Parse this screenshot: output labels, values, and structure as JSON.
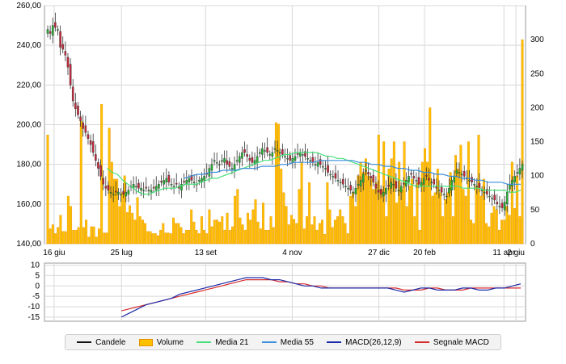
{
  "colors": {
    "grid": "#d8d8d8",
    "frame": "#9a9a9a",
    "candle_up": "#22b530",
    "candle_down": "#c7263a",
    "volume_fill": "#ffc000",
    "volume_stroke": "#e89000",
    "media21": "#46e07a",
    "media55": "#3a8fdc",
    "macd": "#1a2aa8",
    "signal": "#d62a2a"
  },
  "price_axis": {
    "min": 140,
    "max": 260,
    "ticks": [
      "140,00",
      "160,00",
      "180,00",
      "200,00",
      "220,00",
      "240,00",
      "260,00"
    ]
  },
  "volume_axis": {
    "min": 0,
    "max": 350,
    "ticks": [
      "0",
      "50",
      "100",
      "150",
      "200",
      "250",
      "300"
    ]
  },
  "macd_axis": {
    "min": -17,
    "max": 11,
    "ticks": [
      "10",
      "5",
      "0",
      "-5",
      "-10",
      "-15"
    ]
  },
  "x_axis": {
    "labels": [
      {
        "text": "16 giu",
        "t": 0.02
      },
      {
        "text": "25 lug",
        "t": 0.16
      },
      {
        "text": "13 set",
        "t": 0.335
      },
      {
        "text": "4 nov",
        "t": 0.515
      },
      {
        "text": "27 dic",
        "t": 0.695
      },
      {
        "text": "20 feb",
        "t": 0.79
      },
      {
        "text": "11 apr",
        "t": 0.955
      },
      {
        "text": "2 giu",
        "t": 0.98
      }
    ]
  },
  "chart_data": {
    "type": "candlestick",
    "price_close": [
      248,
      246,
      250,
      249,
      248,
      239,
      238,
      235,
      229,
      220,
      212,
      208,
      205,
      202,
      198,
      196,
      193,
      190,
      186,
      182,
      178,
      174,
      170,
      168,
      167,
      166,
      165,
      166,
      166,
      165,
      165,
      166,
      167,
      169,
      170,
      169,
      168,
      168,
      167,
      168,
      167,
      167,
      168,
      169,
      170,
      171,
      172,
      173,
      171,
      170,
      169,
      170,
      168,
      170,
      171,
      172,
      173,
      172,
      171,
      170,
      172,
      173,
      174,
      175,
      178,
      180,
      182,
      181,
      180,
      182,
      183,
      180,
      179,
      178,
      180,
      182,
      184,
      186,
      186,
      184,
      182,
      181,
      182,
      184,
      186,
      188,
      187,
      186,
      185,
      186,
      188,
      187,
      186,
      185,
      184,
      183,
      182,
      183,
      184,
      185,
      186,
      185,
      184,
      183,
      182,
      181,
      180,
      181,
      180,
      179,
      178,
      176,
      175,
      174,
      173,
      172,
      171,
      170,
      169,
      168,
      167,
      166,
      168,
      170,
      172,
      175,
      177,
      175,
      173,
      171,
      168,
      166,
      165,
      166,
      168,
      169,
      171,
      170,
      168,
      167,
      169,
      170,
      172,
      174,
      175,
      173,
      172,
      170,
      171,
      173,
      174,
      172,
      171,
      170,
      168,
      167,
      166,
      165,
      164,
      168,
      172,
      174,
      177,
      176,
      175,
      174,
      173,
      172,
      171,
      170,
      169,
      168,
      167,
      166,
      165,
      164,
      163,
      162,
      160,
      159,
      158,
      161,
      166,
      170,
      172,
      174,
      176,
      178,
      180
    ],
    "media21": [
      178,
      176,
      175,
      172,
      170,
      168,
      166,
      165,
      165,
      166,
      167,
      168,
      168,
      168,
      169,
      170,
      170,
      170,
      171,
      172,
      173,
      173,
      174,
      175,
      176,
      177,
      178,
      179,
      180,
      181,
      182,
      182,
      183,
      184,
      185,
      185,
      186,
      186,
      186,
      186,
      186,
      185,
      184,
      184,
      183,
      183,
      182,
      181,
      180,
      179,
      178,
      177,
      176,
      175,
      174,
      173,
      172,
      171,
      170,
      169,
      169,
      169,
      169,
      169,
      169,
      169,
      169,
      169,
      168,
      168,
      168,
      168,
      167,
      167,
      167,
      167,
      167,
      166,
      166,
      167
    ],
    "media55": [
      173,
      174,
      175,
      175,
      176,
      176,
      177,
      177,
      177,
      178,
      178,
      178,
      179,
      179,
      179,
      180,
      180,
      181,
      181,
      181,
      181,
      182,
      182,
      182,
      182,
      182,
      182,
      181,
      181,
      180,
      180,
      179,
      179,
      178,
      178,
      177,
      177,
      176,
      176,
      175,
      175,
      174,
      174,
      173,
      173,
      172,
      172,
      171,
      171,
      171,
      170,
      170,
      170
    ],
    "volume": [
      160,
      22,
      28,
      15,
      24,
      42,
      18,
      18,
      70,
      55,
      20,
      20,
      24,
      180,
      24,
      35,
      10,
      25,
      25,
      10,
      22,
      205,
      16,
      16,
      170,
      120,
      95,
      95,
      55,
      75,
      100,
      46,
      56,
      45,
      35,
      68,
      40,
      35,
      30,
      18,
      18,
      15,
      15,
      12,
      20,
      30,
      16,
      16,
      15,
      38,
      30,
      30,
      24,
      15,
      20,
      20,
      50,
      32,
      20,
      15,
      40,
      20,
      15,
      50,
      25,
      35,
      35,
      32,
      40,
      20,
      45,
      20,
      25,
      70,
      80,
      38,
      28,
      20,
      45,
      35,
      50,
      65,
      32,
      22,
      60,
      20,
      20,
      40,
      24,
      178,
      176,
      110,
      75,
      55,
      28,
      42,
      36,
      30,
      80,
      120,
      22,
      40,
      90,
      28,
      40,
      20,
      30,
      35,
      14,
      90,
      50,
      24,
      35,
      40,
      50,
      40,
      30,
      15,
      70,
      76,
      55,
      100,
      120,
      105,
      125,
      100,
      95,
      80,
      90,
      160,
      80,
      150,
      40,
      110,
      125,
      150,
      60,
      120,
      80,
      150,
      55,
      85,
      95,
      40,
      90,
      20,
      120,
      140,
      120,
      200,
      70,
      75,
      110,
      75,
      40,
      65,
      75,
      105,
      40,
      130,
      110,
      145,
      80,
      70,
      150,
      35,
      30,
      85,
      160,
      70,
      95,
      30,
      25,
      45,
      55,
      50,
      20,
      35,
      35,
      55,
      42,
      120,
      52,
      100,
      40,
      300
    ],
    "macd": [
      -15,
      -13,
      -11,
      -9,
      -8,
      -7,
      -6,
      -4,
      -3,
      -2,
      -1,
      0,
      1,
      2,
      3,
      4,
      4,
      4,
      3,
      3,
      2,
      1,
      0,
      0,
      -1,
      -1,
      -1,
      -1,
      -1,
      -1,
      -1,
      -1,
      -1,
      -2,
      -3,
      -2,
      -1,
      -1,
      -2,
      -2,
      -2,
      -1,
      -1,
      -2,
      -2,
      -1,
      -1,
      0,
      1
    ],
    "signal": [
      -12,
      -11,
      -10,
      -9,
      -8,
      -7,
      -6,
      -5,
      -4,
      -3,
      -2,
      -1,
      0,
      1,
      2,
      3,
      3,
      3,
      3,
      2,
      2,
      1,
      1,
      0,
      0,
      -1,
      -1,
      -1,
      -1,
      -1,
      -1,
      -1,
      -1,
      -1,
      -2,
      -2,
      -2,
      -1,
      -1,
      -2,
      -2,
      -2,
      -1,
      -1,
      -1,
      -1,
      -1,
      -1,
      -1
    ]
  },
  "legend": {
    "candles": "Candele",
    "volume": "Volume",
    "media21": "Media 21",
    "media55": "Media 55",
    "macd": "MACD(26,12,9)",
    "signal": "Segnale MACD"
  }
}
